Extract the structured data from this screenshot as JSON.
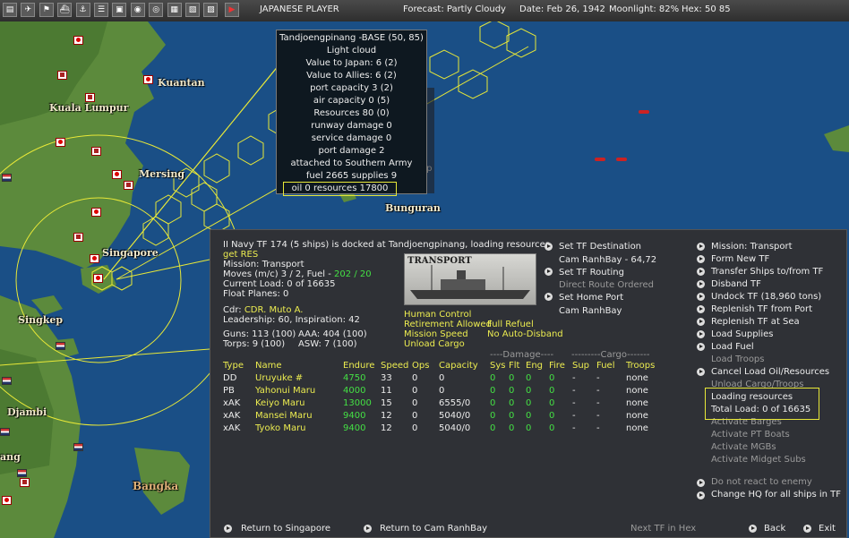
{
  "toolbar": {
    "icons": [
      "map-icon",
      "air-icon",
      "ground-icon",
      "ship-icon",
      "port-icon",
      "task-icon",
      "base-icon",
      "intel-icon",
      "globe-icon",
      "report-icon",
      "reinforce-icon",
      "info-icon",
      "end-turn-icon"
    ],
    "player": "JAPANESE PLAYER",
    "forecast": "Forecast: Partly Cloudy",
    "date": "Date: Feb 26, 1942",
    "moonlight": "Moonlight: 82%",
    "hex": "Hex: 50 85"
  },
  "map": {
    "labels": {
      "kuantan": "Kuantan",
      "kuala_lumpur": "Kuala Lumpur",
      "mersing": "Mersing",
      "singapore": "Singapore",
      "singkep": "Singkep",
      "djambi": "Djambi",
      "bangka": "Bangka",
      "bunguran": "Bunguran",
      "jang": "ang"
    },
    "colors": {
      "sea": "#1a4f86",
      "land": "#5f8c3e",
      "hex_grid": "#e8e838"
    }
  },
  "tooltip": {
    "lines": [
      "Tandjoengpinang -BASE (50, 85)",
      "Light cloud",
      "Value to Japan: 6 (2)",
      "Value to Allies: 6 (2)",
      "port capacity 3 (2)",
      "air capacity 0 (5)",
      "Resources 80 (0)",
      "runway damage 0",
      "service damage 0",
      "port damage 2",
      "attached to Southern Army",
      "fuel 2665 supplies 9",
      "oil 0 resources 17800"
    ]
  },
  "ghost_panel": {
    "lines": [
      "TF 174 (5 s",
      "in: Transpo",
      "(m/c) 3 / 2",
      "ent Load: 0 of",
      "t Planes: 0",
      "CDR Muto A.",
      "ership: 60, Insp"
    ]
  },
  "panel": {
    "header": "II Navy TF 174 (5 ships) is docked at Tandjoengpinang, loading resources",
    "get_res": "get RES",
    "mission": "Mission: Transport",
    "moves_prefix": "Moves (m/c) 3 / 2, Fuel - ",
    "moves_fuel": "202 / 20",
    "current_load": "Current Load: 0 of 16635",
    "float_planes": "Float Planes: 0",
    "cdr_label": "Cdr:",
    "cdr_name": "CDR. Muto A.",
    "leadership": "Leadership: 60, Inspiration: 42",
    "guns": "Guns: 113 (100)",
    "aaa": "AAA: 404 (100)",
    "torps": "Torps: 9 (100)",
    "asw": "ASW: 7 (100)",
    "ship_image_caption": "TRANSPORT",
    "human_control": "Human Control",
    "retirement": "Retirement Allowed",
    "full_refuel": "Full Refuel",
    "mission_speed": "Mission Speed",
    "no_auto_disband": "No Auto-Disband",
    "unload_cargo": "Unload Cargo",
    "mid_commands": {
      "set_dest": "Set TF Destination",
      "dest_value": "Cam RanhBay - 64,72",
      "set_routing": "Set TF Routing",
      "routing_value": "Direct Route Ordered",
      "set_home": "Set Home Port",
      "home_value": "Cam RanhBay"
    },
    "right_commands": [
      {
        "label": "Mission: Transport",
        "arrow": true,
        "dim": false
      },
      {
        "label": "Form New TF",
        "arrow": true,
        "dim": false
      },
      {
        "label": "Transfer Ships to/from TF",
        "arrow": true,
        "dim": false
      },
      {
        "label": "Disband TF",
        "arrow": true,
        "dim": false
      },
      {
        "label": "Undock TF (18,960 tons)",
        "arrow": true,
        "dim": false
      },
      {
        "label": "Replenish TF from Port",
        "arrow": true,
        "dim": false
      },
      {
        "label": "Replenish TF at Sea",
        "arrow": true,
        "dim": false
      },
      {
        "label": "Load Supplies",
        "arrow": true,
        "dim": false
      },
      {
        "label": "Load Fuel",
        "arrow": true,
        "dim": false
      },
      {
        "label": "Load Troops",
        "arrow": false,
        "dim": true
      },
      {
        "label": "Cancel Load Oil/Resources",
        "arrow": true,
        "dim": false
      },
      {
        "label": "Unload Cargo/Troops",
        "arrow": false,
        "dim": true
      },
      {
        "label": "Loading resources",
        "arrow": false,
        "dim": false
      },
      {
        "label": "Total Load: 0 of 16635",
        "arrow": false,
        "dim": false
      },
      {
        "label": "Activate Barges",
        "arrow": false,
        "dim": true
      },
      {
        "label": "Activate PT Boats",
        "arrow": false,
        "dim": true
      },
      {
        "label": "Activate MGBs",
        "arrow": false,
        "dim": true
      },
      {
        "label": "Activate Midget Subs",
        "arrow": false,
        "dim": true
      }
    ],
    "do_not_react": "Do not react to enemy",
    "change_hq": "Change HQ for all ships in TF",
    "table": {
      "damage_heading": "----Damage----",
      "cargo_heading": "---------Cargo-------",
      "columns": [
        "Type",
        "Name",
        "Endure",
        "Speed",
        "Ops",
        "Capacity",
        "Sys",
        "Flt",
        "Eng",
        "Fire",
        "Sup",
        "Fuel",
        "Troops"
      ],
      "rows": [
        [
          "DD",
          "Uruyuke #",
          "4750",
          "33",
          "0",
          "0",
          "0",
          "0",
          "0",
          "0",
          "-",
          "-",
          "none"
        ],
        [
          "PB",
          "Yahonui Maru",
          "4000",
          "11",
          "0",
          "0",
          "0",
          "0",
          "0",
          "0",
          "-",
          "-",
          "none"
        ],
        [
          "xAK",
          "Keiyo Maru",
          "13000",
          "15",
          "0",
          "6555/0",
          "0",
          "0",
          "0",
          "0",
          "-",
          "-",
          "none"
        ],
        [
          "xAK",
          "Mansei Maru",
          "9400",
          "12",
          "0",
          "5040/0",
          "0",
          "0",
          "0",
          "0",
          "-",
          "-",
          "none"
        ],
        [
          "xAK",
          "Tyoko Maru",
          "9400",
          "12",
          "0",
          "5040/0",
          "0",
          "0",
          "0",
          "0",
          "-",
          "-",
          "none"
        ]
      ]
    },
    "footer": {
      "return_singapore": "Return to Singapore",
      "return_cam": "Return to Cam RanhBay",
      "next_tf": "Next TF in Hex",
      "back": "Back",
      "exit": "Exit"
    }
  }
}
